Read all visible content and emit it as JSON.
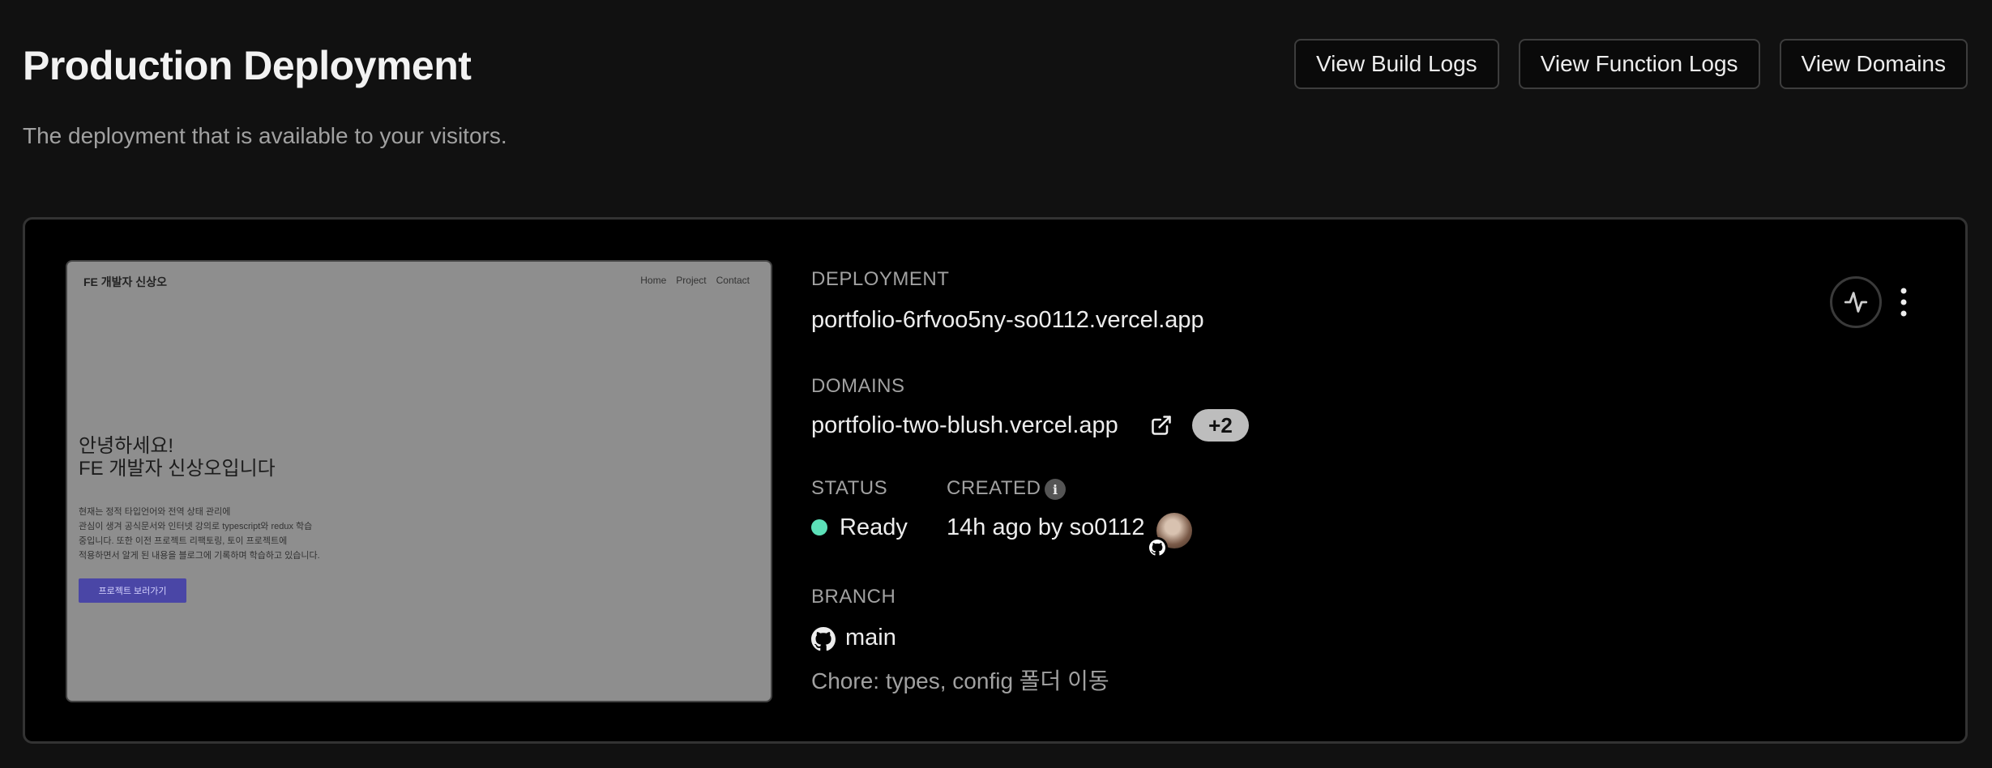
{
  "header": {
    "title": "Production Deployment",
    "subtitle": "The deployment that is available to your visitors.",
    "buttons": {
      "build_logs": "View Build Logs",
      "function_logs": "View Function Logs",
      "domains": "View Domains"
    }
  },
  "preview": {
    "brand": "FE 개발자 신상오",
    "nav": [
      "Home",
      "Project",
      "Contact"
    ],
    "heading_line1": "안녕하세요!",
    "heading_line2": "FE 개발자 신상오입니다",
    "body_lines": [
      "현재는 정적 타입언어와 전역 상태 관리에",
      "관심이 생겨 공식문서와 인터넷 강의로 typescript와 redux 학습",
      "중입니다. 또한 이전 프로젝트 리팩토링, 토이 프로젝트에",
      "적용하면서 알게 된 내용을 블로그에 기록하며 학습하고 있습니다."
    ],
    "button": "프로젝트 보러가기"
  },
  "deployment": {
    "label": "DEPLOYMENT",
    "url": "portfolio-6rfvoo5ny-so0112.vercel.app"
  },
  "domains": {
    "label": "DOMAINS",
    "primary": "portfolio-two-blush.vercel.app",
    "extra_count": "+2"
  },
  "status": {
    "label": "STATUS",
    "value": "Ready",
    "color": "#5ce0b8"
  },
  "created": {
    "label": "CREATED",
    "info_icon": "i",
    "value": "14h ago by so0112"
  },
  "branch": {
    "label": "BRANCH",
    "name": "main",
    "commit_message": "Chore: types, config 폴더 이동"
  },
  "icons": {
    "external_link": "external-link-icon",
    "activity": "activity-icon",
    "more": "kebab-menu-icon",
    "github": "github-icon"
  }
}
